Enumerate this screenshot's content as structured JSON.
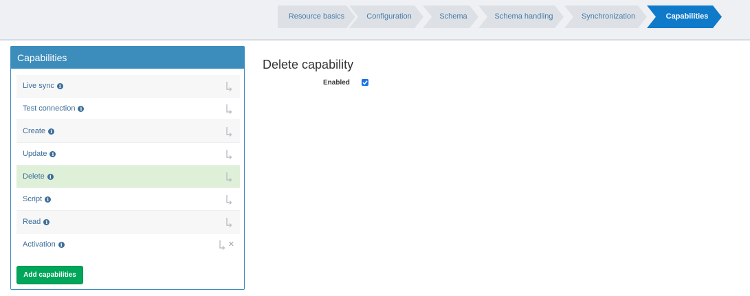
{
  "wizard": {
    "steps": [
      {
        "label": "Resource basics",
        "active": false
      },
      {
        "label": "Configuration",
        "active": false
      },
      {
        "label": "Schema",
        "active": false
      },
      {
        "label": "Schema handling",
        "active": false
      },
      {
        "label": "Synchronization",
        "active": false
      },
      {
        "label": "Capabilities",
        "active": true
      }
    ]
  },
  "panel": {
    "title": "Capabilities",
    "items": [
      {
        "label": "Live sync"
      },
      {
        "label": "Test connection"
      },
      {
        "label": "Create"
      },
      {
        "label": "Update"
      },
      {
        "label": "Delete"
      },
      {
        "label": "Script"
      },
      {
        "label": "Read"
      },
      {
        "label": "Activation"
      }
    ],
    "selected_item": "Delete",
    "add_button": "Add capabilities"
  },
  "content": {
    "title": "Delete capability",
    "enabled_label": "Enabled",
    "enabled": true
  },
  "colors": {
    "accent": "#3c8dbc",
    "active_step": "#0f7ac9",
    "inactive_step": "#dde1e6",
    "selected_row": "#dff0d8",
    "button": "#00a65a"
  },
  "icons": {
    "info": "info-icon",
    "inherit": "inherit-arrow-icon",
    "remove": "close-icon"
  }
}
